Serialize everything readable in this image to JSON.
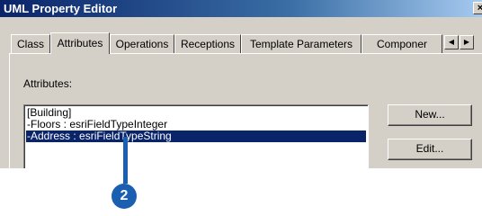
{
  "window": {
    "title": "UML Property Editor",
    "close_glyph": "×"
  },
  "tabs": [
    {
      "label": "Class",
      "active": false
    },
    {
      "label": "Attributes",
      "active": true
    },
    {
      "label": "Operations",
      "active": false
    },
    {
      "label": "Receptions",
      "active": false
    },
    {
      "label": "Template Parameters",
      "active": false
    },
    {
      "label": "Componer",
      "active": false
    }
  ],
  "tab_scroll": {
    "left_icon": "◀",
    "right_icon": "▶"
  },
  "attributes": {
    "label": "Attributes:",
    "items": [
      {
        "text": "[Building]",
        "selected": false
      },
      {
        "text": "-Floors : esriFieldTypeInteger",
        "selected": false
      },
      {
        "text": "-Address : esriFieldTypeString",
        "selected": true
      }
    ]
  },
  "buttons": {
    "new": "New...",
    "edit": "Edit..."
  },
  "callout": {
    "number": "2",
    "color": "#1b5fb0"
  }
}
